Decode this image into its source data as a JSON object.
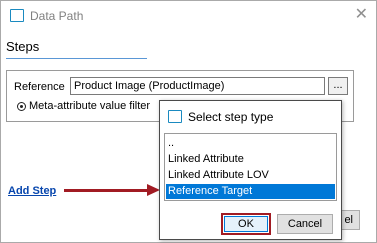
{
  "window": {
    "title": "Data Path",
    "close_glyph": "✕"
  },
  "steps": {
    "header": "Steps",
    "reference_label": "Reference",
    "reference_value": "Product Image (ProductImage)",
    "browse_label": "...",
    "meta_label": "Meta-attribute value filter",
    "add_step": "Add Step",
    "bg_cancel_label": "el"
  },
  "dialog": {
    "title": "Select step type",
    "items": [
      {
        "label": "..",
        "selected": false
      },
      {
        "label": "Linked Attribute",
        "selected": false
      },
      {
        "label": "Linked Attribute LOV",
        "selected": false
      },
      {
        "label": "Reference Target",
        "selected": true
      }
    ],
    "ok_label": "OK",
    "cancel_label": "Cancel"
  },
  "colors": {
    "annotation_red": "#a11b23",
    "selection_blue": "#0078d7",
    "link_blue": "#0645ad",
    "icon_blue": "#1a8ac0"
  },
  "icons": {
    "window_icon": "window-icon",
    "close_icon": "close-icon",
    "radio_icon": "radio-selected-icon",
    "annotation_arrow": "arrow-right-icon"
  }
}
